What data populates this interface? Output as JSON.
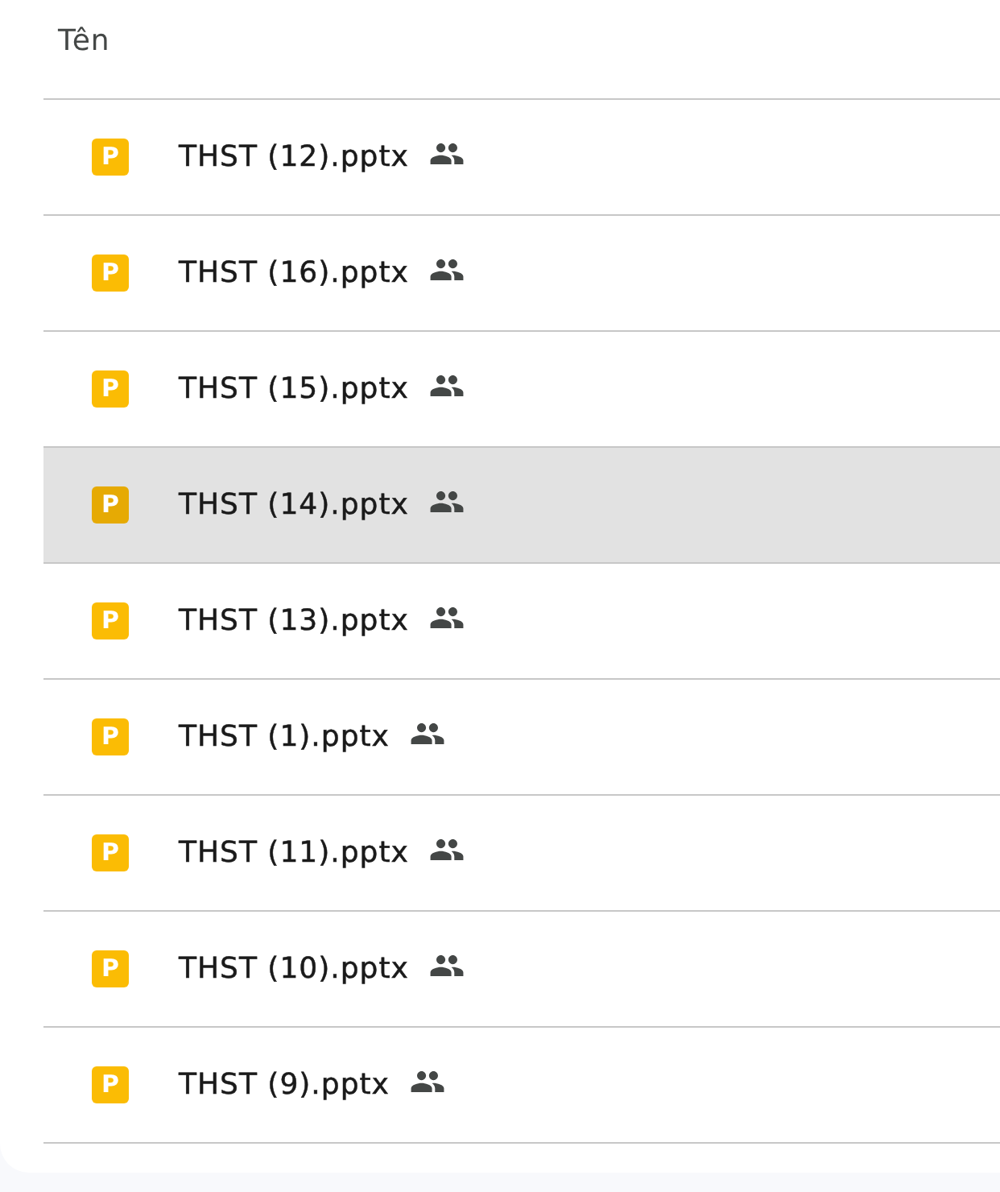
{
  "column_header": {
    "label": "Tên"
  },
  "files": [
    {
      "name": "THST (12).pptx",
      "icon_letter": "P",
      "shared": true,
      "highlighted": false
    },
    {
      "name": "THST (16).pptx",
      "icon_letter": "P",
      "shared": true,
      "highlighted": false
    },
    {
      "name": "THST (15).pptx",
      "icon_letter": "P",
      "shared": true,
      "highlighted": false
    },
    {
      "name": "THST (14).pptx",
      "icon_letter": "P",
      "shared": true,
      "highlighted": true
    },
    {
      "name": "THST (13).pptx",
      "icon_letter": "P",
      "shared": true,
      "highlighted": false
    },
    {
      "name": "THST (1).pptx",
      "icon_letter": "P",
      "shared": true,
      "highlighted": false
    },
    {
      "name": "THST (11).pptx",
      "icon_letter": "P",
      "shared": true,
      "highlighted": false
    },
    {
      "name": "THST (10).pptx",
      "icon_letter": "P",
      "shared": true,
      "highlighted": false
    },
    {
      "name": "THST (9).pptx",
      "icon_letter": "P",
      "shared": true,
      "highlighted": false
    }
  ]
}
